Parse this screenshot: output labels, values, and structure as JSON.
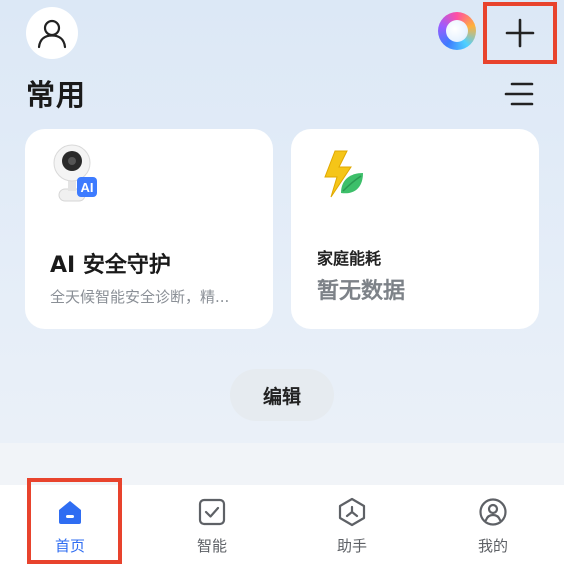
{
  "header": {
    "avatar_icon": "person-icon",
    "assistant_icon": "assistant-orb-icon",
    "add_icon": "plus-icon"
  },
  "section": {
    "title": "常用",
    "menu_icon": "list-menu-icon"
  },
  "cards": [
    {
      "icon": "security-camera-ai-icon",
      "icon_badge": "AI",
      "title": "AI 安全守护",
      "subtitle": "全天候智能安全诊断，精..."
    },
    {
      "icon": "energy-leaf-icon",
      "title": "家庭能耗",
      "value": "暂无数据"
    }
  ],
  "edit_button": {
    "label": "编辑"
  },
  "tabbar": {
    "active_color": "#2f6df2",
    "items": [
      {
        "label": "首页",
        "icon": "home-icon",
        "active": true
      },
      {
        "label": "智能",
        "icon": "check-square-icon",
        "active": false
      },
      {
        "label": "助手",
        "icon": "assistant-hexagon-icon",
        "active": false
      },
      {
        "label": "我的",
        "icon": "profile-circle-icon",
        "active": false
      }
    ]
  },
  "highlight_color": "#e8432d"
}
